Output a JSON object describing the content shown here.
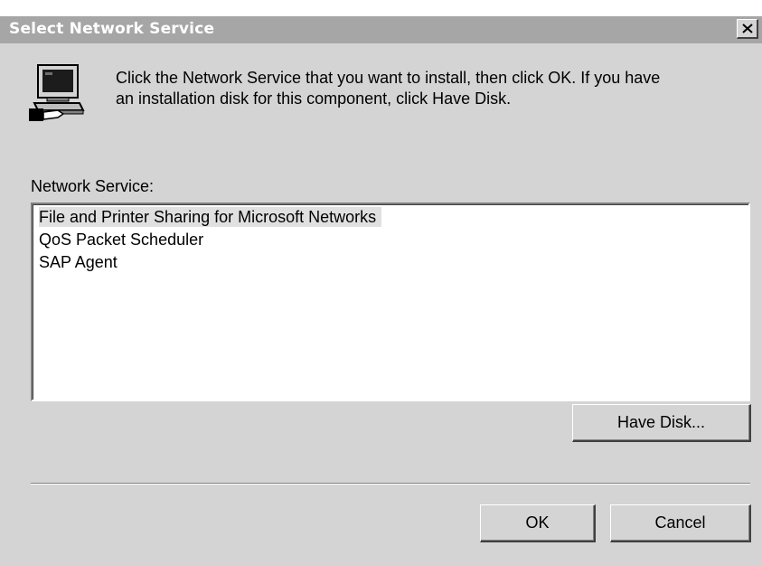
{
  "window": {
    "title": "Select Network Service",
    "close_icon": "close-x-icon"
  },
  "header": {
    "icon": "computer-install-icon",
    "instruction_line1": "Click the Network Service that you want to install, then click OK. If you have",
    "instruction_line2": "an installation disk for this component, click Have Disk."
  },
  "service_list": {
    "label": "Network Service:",
    "items": [
      {
        "label": "File and Printer Sharing for Microsoft Networks",
        "selected": true
      },
      {
        "label": "QoS Packet Scheduler",
        "selected": false
      },
      {
        "label": "SAP Agent",
        "selected": false
      }
    ]
  },
  "buttons": {
    "have_disk": "Have Disk...",
    "ok": "OK",
    "cancel": "Cancel"
  },
  "colors": {
    "dialog_bg": "#d4d4d4",
    "titlebar_bg": "#a6a6a6",
    "selection_bg": "#e0e0e0"
  }
}
